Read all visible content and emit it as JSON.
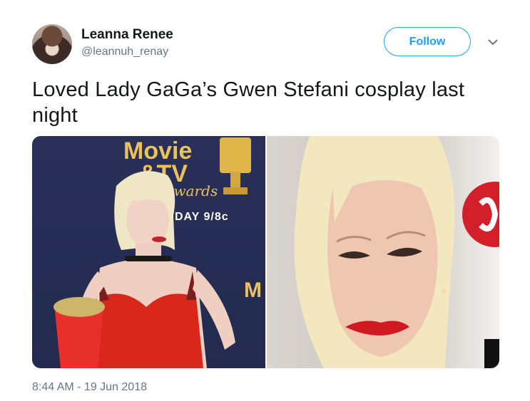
{
  "tweet": {
    "author_name": "Leanna Renee",
    "author_handle": "@leannuh_renay",
    "follow_label": "Follow",
    "text": "Loved Lady GaGa’s Gwen Stefani cosplay last night",
    "timestamp": "8:44 AM - 19 Jun 2018"
  },
  "media": {
    "left_photo": {
      "backdrop_lines": [
        "Movie",
        "&TV",
        "Awards"
      ],
      "backdrop_date": "DAY 9/8c"
    }
  },
  "colors": {
    "accent": "#1da1f2",
    "secondary_text": "#657786",
    "primary_text": "#14171a"
  },
  "icons": {
    "menu": "chevron-down-icon"
  }
}
